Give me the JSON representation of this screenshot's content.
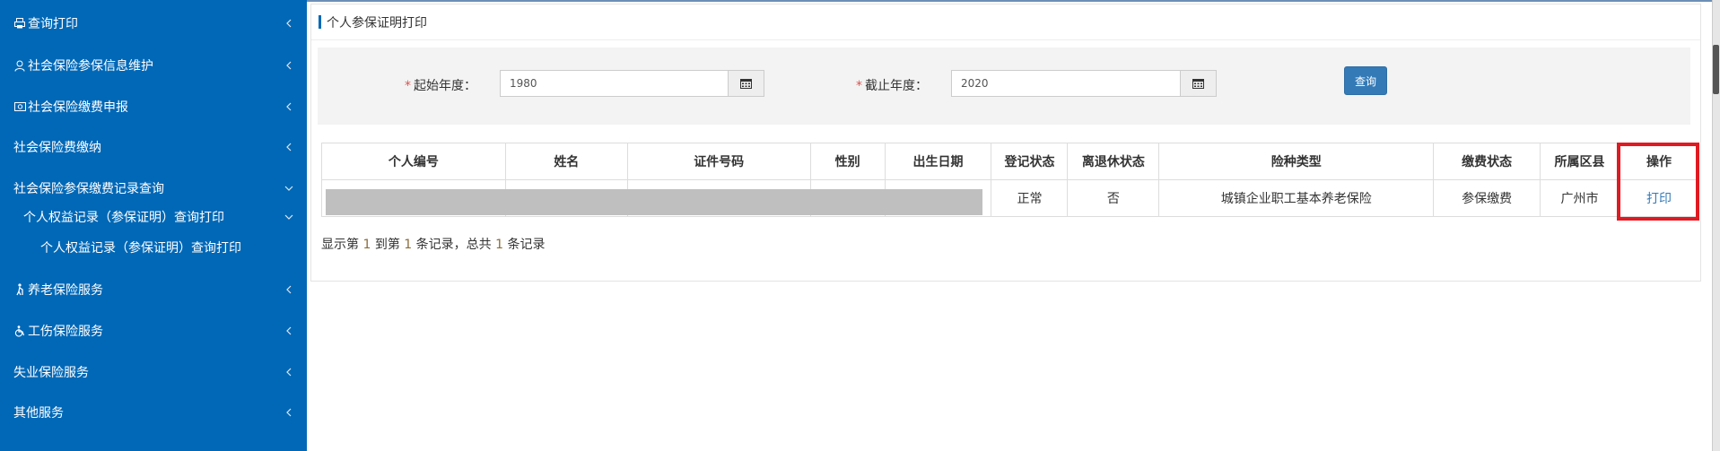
{
  "sidebar": {
    "items": [
      {
        "label": "查询打印",
        "icon": "print-icon"
      },
      {
        "label": "社会保险参保信息维护",
        "icon": "user-icon"
      },
      {
        "label": "社会保险缴费申报",
        "icon": "money-icon"
      },
      {
        "label": "社会保险费缴纳"
      },
      {
        "label": "社会保险参保缴费记录查询"
      },
      {
        "label": "个人权益记录（参保证明）查询打印"
      },
      {
        "label": "个人权益记录（参保证明）查询打印"
      },
      {
        "label": "养老保险服务",
        "icon": "elderly-icon"
      },
      {
        "label": "工伤保险服务",
        "icon": "wheelchair-icon"
      },
      {
        "label": "失业保险服务"
      },
      {
        "label": "其他服务"
      }
    ]
  },
  "panel": {
    "title": "个人参保证明打印"
  },
  "filter": {
    "start_label": "起始年度：",
    "start_value": "1980",
    "end_label": "截止年度：",
    "end_value": "2020",
    "required_mark": "*",
    "query_label": "查询"
  },
  "table": {
    "headers": [
      "个人编号",
      "姓名",
      "证件号码",
      "性别",
      "出生日期",
      "登记状态",
      "离退休状态",
      "险种类型",
      "缴费状态",
      "所属区县",
      "操作"
    ],
    "row": {
      "register_status": "正常",
      "retired_status": "否",
      "insurance_type": "城镇企业职工基本养老保险",
      "payment_status": "参保缴费",
      "district": "广州市",
      "action": "打印"
    }
  },
  "footer": {
    "prefix": "显示第",
    "from": "1",
    "mid1": "到第",
    "to": "1",
    "mid2": "条记录，总共",
    "total": "1",
    "suffix": "条记录"
  },
  "colors": {
    "sidebar_bg": "#0168b7",
    "accent": "#337ab7",
    "highlight": "#e01a22"
  }
}
